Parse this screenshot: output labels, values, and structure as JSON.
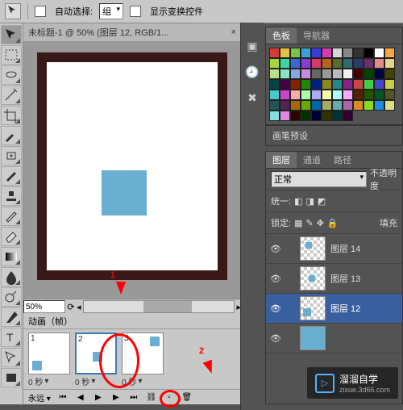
{
  "toolbar": {
    "auto_select": "自动选择:",
    "group": "组",
    "show_transform": "显示变换控件"
  },
  "doc": {
    "title": "未标题-1 @ 50% (图层 12, RGB/1..."
  },
  "zoom": "50%",
  "anim": {
    "title": "动画（帧）",
    "frames": [
      {
        "num": "1",
        "time": "0 秒",
        "pos": "bl"
      },
      {
        "num": "2",
        "time": "0 秒",
        "pos": "c"
      },
      {
        "num": "3",
        "time": "0 秒",
        "pos": "tr"
      }
    ],
    "loop": "永远"
  },
  "panels": {
    "swatch_tab1": "色板",
    "swatch_tab2": "导航器",
    "brush": "画笔预设",
    "lp_tab1": "图层",
    "lp_tab2": "通道",
    "lp_tab3": "路径",
    "blend": "正常",
    "opacity_label": "不透明度",
    "unify": "统一:",
    "lock": "锁定:",
    "fill": "填充",
    "layers": [
      {
        "name": "图层 14"
      },
      {
        "name": "图层 13"
      },
      {
        "name": "图层 12"
      },
      {
        "name": ""
      }
    ]
  },
  "ann": {
    "a": "1",
    "b": "2"
  },
  "swatch_colors": [
    "#d63b3b",
    "#e2c341",
    "#7bc24a",
    "#3b9ed6",
    "#3b3bd6",
    "#d63bb0",
    "#d6d6d6",
    "#888",
    "#333",
    "#000",
    "#fff",
    "#f4a742",
    "#a7d63b",
    "#3bd6a7",
    "#3b68d6",
    "#8a3bd6",
    "#d63b68",
    "#b5651d",
    "#556b2f",
    "#2f6b6b",
    "#2f3b6b",
    "#6b2f6b",
    "#e28b8b",
    "#e2d98b",
    "#b6e28b",
    "#8be2c9",
    "#8ba7e2",
    "#c98be2",
    "#666",
    "#999",
    "#bbb",
    "#eee",
    "#400",
    "#040",
    "#004",
    "#440",
    "#044",
    "#404",
    "#820",
    "#280",
    "#028",
    "#882",
    "#288",
    "#828",
    "#c44",
    "#4c4",
    "#44c",
    "#cc4",
    "#4cc",
    "#c4c",
    "#faa",
    "#afa",
    "#aaf",
    "#ffa",
    "#aff",
    "#faf",
    "#520",
    "#250",
    "#052",
    "#552",
    "#255",
    "#525",
    "#a60",
    "#6a0",
    "#06a",
    "#aa6",
    "#6aa",
    "#a6a",
    "#d82",
    "#8d2",
    "#28d",
    "#dd8",
    "#8dd",
    "#d8d",
    "#300",
    "#030",
    "#003",
    "#330",
    "#033",
    "#303"
  ],
  "watermark": {
    "brand": "溜溜自学",
    "url": "zixue.3d66.com"
  }
}
